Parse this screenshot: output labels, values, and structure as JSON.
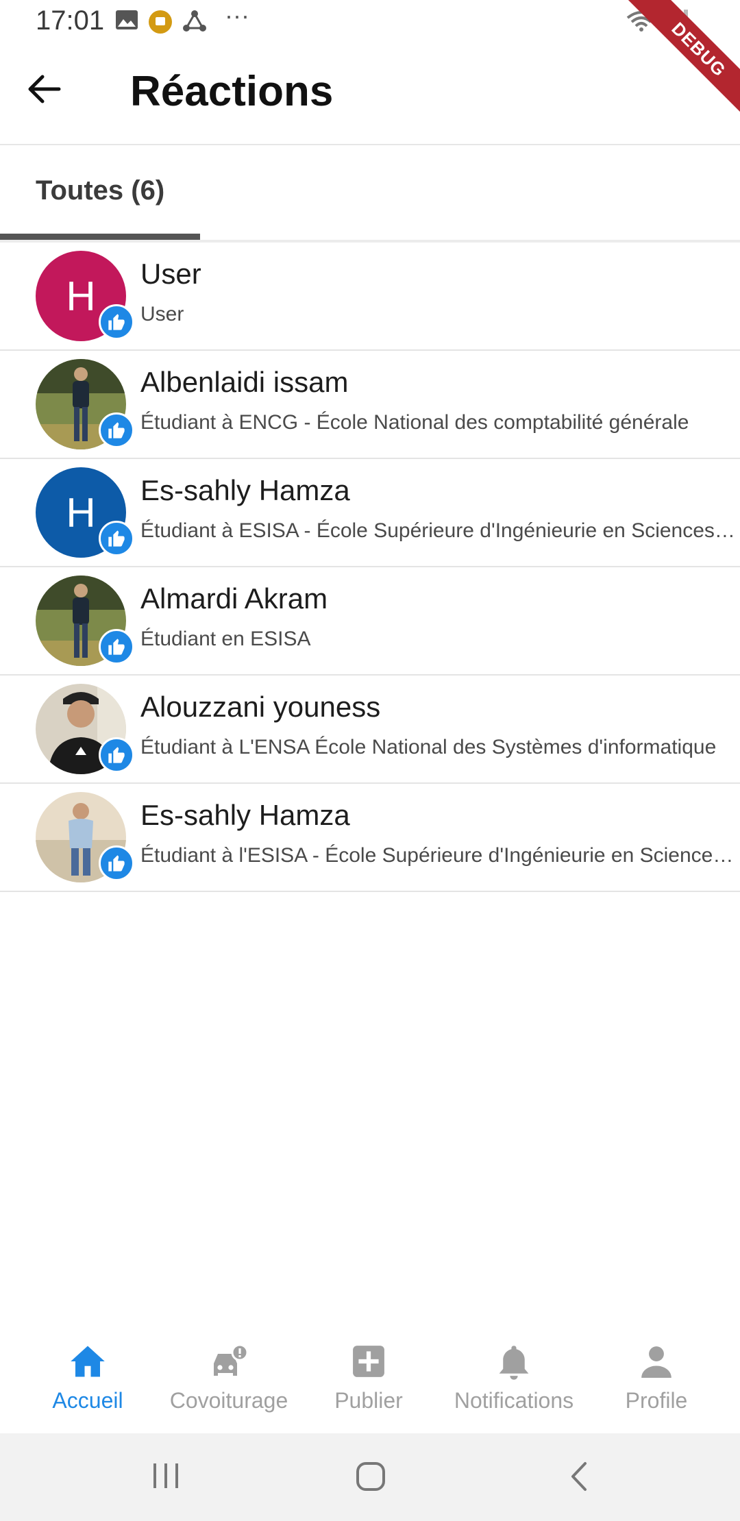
{
  "status_bar": {
    "time": "17:01",
    "overflow": "···"
  },
  "debug_label": "DEBUG",
  "app_bar": {
    "title": "Réactions"
  },
  "tabs": [
    {
      "label": "Toutes (6)",
      "selected": true
    }
  ],
  "reactions": [
    {
      "name": "User",
      "subtitle": "User",
      "avatar_letter": "H",
      "avatar_color": "#c2185b",
      "avatar_type": "letter"
    },
    {
      "name": "Albenlaidi issam",
      "subtitle": "Étudiant à ENCG - École National des comptabilité générale",
      "avatar_type": "photo"
    },
    {
      "name": "Es-sahly Hamza",
      "subtitle": "Étudiant à ESISA - École Supérieure d'Ingénieurie en Sciences Appliquées",
      "avatar_letter": "H",
      "avatar_color": "#0d5ba8",
      "avatar_type": "letter"
    },
    {
      "name": "Almardi Akram",
      "subtitle": "Étudiant en ESISA",
      "avatar_type": "photo"
    },
    {
      "name": "Alouzzani youness",
      "subtitle": "Étudiant à L'ENSA École National des Systèmes d'informatique",
      "avatar_type": "photo"
    },
    {
      "name": "Es-sahly Hamza",
      "subtitle": "Étudiant à l'ESISA - École Supérieure d'Ingénieurie en Sciences Appliquées",
      "avatar_type": "photo"
    }
  ],
  "bottom_nav": [
    {
      "label": "Accueil",
      "icon": "home-icon",
      "active": true
    },
    {
      "label": "Covoiturage",
      "icon": "car-alert-icon",
      "active": false
    },
    {
      "label": "Publier",
      "icon": "add-box-icon",
      "active": false
    },
    {
      "label": "Notifications",
      "icon": "bell-icon",
      "active": false
    },
    {
      "label": "Profile",
      "icon": "person-icon",
      "active": false
    }
  ],
  "colors": {
    "accent": "#1e88e5",
    "like_badge": "#1e88e5",
    "inactive_nav": "#a0a0a0",
    "debug_ribbon": "#b3262f"
  }
}
